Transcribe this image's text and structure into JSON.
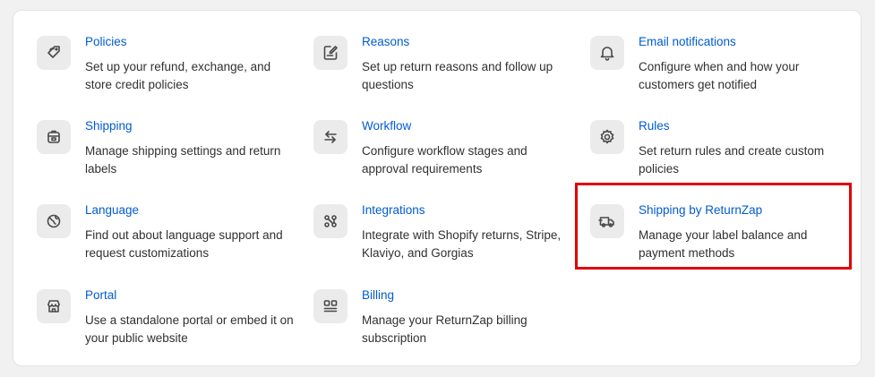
{
  "settings": {
    "items": [
      {
        "title": "Policies",
        "description": "Set up your refund, exchange, and store credit policies",
        "icon": "tag-refresh-icon"
      },
      {
        "title": "Reasons",
        "description": "Set up return reasons and follow up questions",
        "icon": "note-edit-icon"
      },
      {
        "title": "Email notifications",
        "description": "Configure when and how your customers get notified",
        "icon": "bell-icon"
      },
      {
        "title": "Shipping",
        "description": "Manage shipping settings and return labels",
        "icon": "package-icon"
      },
      {
        "title": "Workflow",
        "description": "Configure workflow stages and approval requirements",
        "icon": "arrows-swap-icon"
      },
      {
        "title": "Rules",
        "description": "Set return rules and create custom policies",
        "icon": "gear-icon"
      },
      {
        "title": "Language",
        "description": "Find out about language support and request customizations",
        "icon": "globe-icon"
      },
      {
        "title": "Integrations",
        "description": "Integrate with Shopify returns, Stripe, Klaviyo, and Gorgias",
        "icon": "integration-nodes-icon"
      },
      {
        "title": "Shipping by ReturnZap",
        "description": "Manage your label balance and payment methods",
        "icon": "truck-icon"
      },
      {
        "title": "Portal",
        "description": "Use a standalone portal or embed it on your public website",
        "icon": "storefront-icon"
      },
      {
        "title": "Billing",
        "description": "Manage your ReturnZap billing subscription",
        "icon": "billing-grid-icon"
      }
    ]
  },
  "colors": {
    "link": "#005bd3",
    "text": "#303030",
    "highlight": "#e00000"
  }
}
